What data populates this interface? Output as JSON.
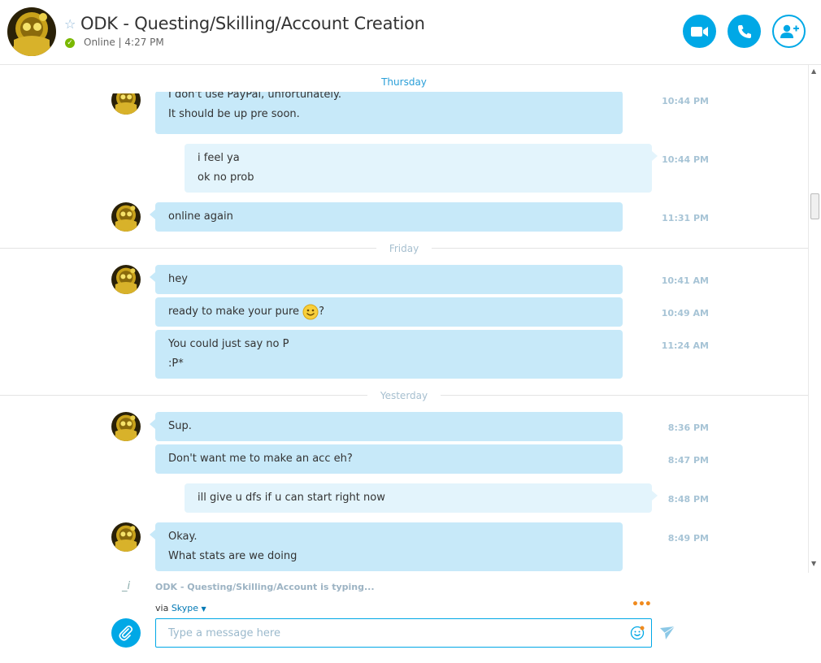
{
  "header": {
    "title": "ODK - Questing/Skilling/Account Creation",
    "status": "Online",
    "separator": "|",
    "time": "4:27 PM"
  },
  "days": {
    "thursday": "Thursday",
    "friday": "Friday",
    "yesterday": "Yesterday"
  },
  "messages": [
    {
      "lines": [
        "I don't use PayPal, unfortunately.",
        "It should be up pre soon."
      ],
      "time": "10:44 PM"
    },
    {
      "lines": [
        "i feel ya",
        "ok no prob"
      ],
      "time": "10:44 PM"
    },
    {
      "lines": [
        "online again"
      ],
      "time": "11:31 PM"
    },
    {
      "lines": [
        "hey"
      ],
      "time": "10:41 AM"
    },
    {
      "lines": [
        "ready to make your pure ",
        "?"
      ],
      "time": "10:49 AM"
    },
    {
      "lines": [
        "You could just say no P",
        ":P*"
      ],
      "time": "11:24 AM"
    },
    {
      "lines": [
        "Sup."
      ],
      "time": "8:36 PM"
    },
    {
      "lines": [
        "Don't want me to make an acc eh?"
      ],
      "time": "8:47 PM"
    },
    {
      "lines": [
        "ill give u dfs if u can start right now"
      ],
      "time": "8:48 PM"
    },
    {
      "lines": [
        "Okay.",
        "What stats are we doing"
      ],
      "time": "8:49 PM"
    }
  ],
  "footer": {
    "typing": "ODK - Questing/Skilling/Account is typing...",
    "via_prefix": "via",
    "via_service": "Skype",
    "input_placeholder": "Type a message here"
  },
  "colors": {
    "accent": "#00a8e6",
    "incoming_bubble": "#c7e9f9",
    "outgoing_bubble": "#e3f4fc",
    "online": "#7ab800",
    "more_dots": "#f08a1e"
  },
  "icons": {
    "favorite": "star-icon",
    "video_call": "video-camera-icon",
    "audio_call": "phone-icon",
    "add_people": "add-person-icon",
    "attach": "paperclip-icon",
    "emoticon": "smiley-icon",
    "send": "send-arrow-icon"
  }
}
